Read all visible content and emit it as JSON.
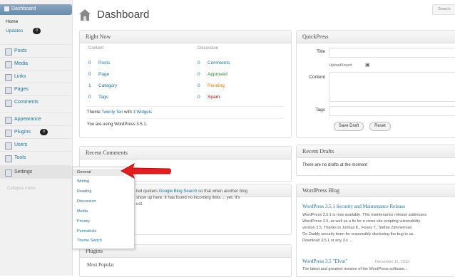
{
  "sidebar": {
    "dashboard": "Dashboard",
    "home": "Home",
    "updates": "Updates",
    "updates_count": "0",
    "items": [
      {
        "label": "Posts"
      },
      {
        "label": "Media"
      },
      {
        "label": "Links"
      },
      {
        "label": "Pages"
      },
      {
        "label": "Comments"
      },
      {
        "label": "Appearance"
      },
      {
        "label": "Plugins",
        "badge": "0"
      },
      {
        "label": "Users"
      },
      {
        "label": "Tools"
      },
      {
        "label": "Settings"
      }
    ],
    "collapse": "Collapse menu"
  },
  "header": {
    "title": "Dashboard",
    "search_label": "Search"
  },
  "right_now": {
    "title": "Right Now",
    "content_label": "Content",
    "discussion_label": "Discussion",
    "content": [
      {
        "count": "0",
        "label": "Posts"
      },
      {
        "count": "0",
        "label": "Page"
      },
      {
        "count": "1",
        "label": "Category"
      },
      {
        "count": "0",
        "label": "Tags"
      }
    ],
    "discussion": [
      {
        "count": "0",
        "label": "Comments",
        "color": "#21759b"
      },
      {
        "count": "0",
        "label": "Approved",
        "color": "#2a8a2a"
      },
      {
        "count": "0",
        "label": "Pending",
        "color": "#e07b00"
      },
      {
        "count": "0",
        "label": "Spam",
        "color": "#cc0000"
      }
    ],
    "theme_prefix": "Theme ",
    "theme_name": "Twenty Ten",
    "theme_mid": " with ",
    "theme_widgets": "3 Widgets",
    "version_text": "You are using WordPress 3.5.1."
  },
  "quickpress": {
    "title": "QuickPress",
    "title_label": "Title",
    "upload_label": "Upload/Insert",
    "content_label": "Content",
    "tags_label": "Tags",
    "save_draft": "Save Draft",
    "reset": "Reset"
  },
  "recent_comments": {
    "title": "Recent Comments"
  },
  "incoming": {
    "text_a": "...ted quoters ",
    "link": "Google Blog Search",
    "text_b": " so that when another blog",
    "text_c": "...show up here. It has found no incoming links ... yet. It's",
    "text_d": "...ust."
  },
  "plugins_box": {
    "title": "Plugins",
    "most_popular": "Most Popular"
  },
  "recent_drafts": {
    "title": "Recent Drafts",
    "empty": "There are no drafts at the moment"
  },
  "wordpress_blog": {
    "title": "WordPress Blog",
    "post1_title": "WordPress 3.5.1 Security and Maintenance Release",
    "post1_lines": [
      "WordPress 3.5.1 is now available. This maintenance release addresses",
      "WordPress 3.5, as well as a fix for a cross-site scripting vulnerability",
      "version 3.5. Thanks to Jonhas K., Fosey T., Stefan Zimmerman",
      "Go Daddy security team for responsibly disclosing the bug to us.",
      "Download 3.5.1 or any 3.x ..."
    ],
    "post2_title": "WordPress 3.5 \"Elvin\"",
    "post2_date": "December 11, 2012",
    "post2_line": "The latest and greatest revision of the WordPress software..."
  },
  "settings_menu": [
    {
      "label": "General"
    },
    {
      "label": "Writing"
    },
    {
      "label": "Reading"
    },
    {
      "label": "Discussion"
    },
    {
      "label": "Media"
    },
    {
      "label": "Privacy"
    },
    {
      "label": "Permalinks"
    },
    {
      "label": "Theme Switch"
    }
  ],
  "colors": {
    "accent": "#21759b",
    "arrow": "#e02020",
    "menu_active": "#6a8bab"
  }
}
